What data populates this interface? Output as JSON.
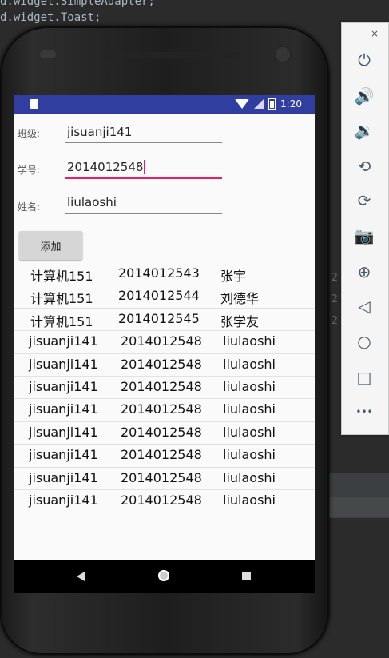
{
  "ide": {
    "line1": "d.widget.SimpleAdapter;",
    "line2": "d.widget.Toast;",
    "gutter": [
      "2",
      "2",
      "2"
    ]
  },
  "statusbar": {
    "time": "1:20"
  },
  "form": {
    "class_label": "班级:",
    "class_value": "jisuanji141",
    "id_label": "学号:",
    "id_value": "2014012548",
    "name_label": "姓名:",
    "name_value": "liulaoshi",
    "add_button": "添加"
  },
  "rows": [
    [
      "计算机151",
      "2014012543",
      "张宇"
    ],
    [
      "计算机151",
      "2014012544",
      "刘德华"
    ],
    [
      "计算机151",
      "2014012545",
      "张学友"
    ],
    [
      "jisuanji141",
      "2014012548",
      "liulaoshi"
    ],
    [
      "jisuanji141",
      "2014012548",
      "liulaoshi"
    ],
    [
      "jisuanji141",
      "2014012548",
      "liulaoshi"
    ],
    [
      "jisuanji141",
      "2014012548",
      "liulaoshi"
    ],
    [
      "jisuanji141",
      "2014012548",
      "liulaoshi"
    ],
    [
      "jisuanji141",
      "2014012548",
      "liulaoshi"
    ],
    [
      "jisuanji141",
      "2014012548",
      "liulaoshi"
    ],
    [
      "jisuanji141",
      "2014012548",
      "liulaoshi"
    ]
  ],
  "toolbar": {
    "minimize": "–",
    "close": "×",
    "buttons": [
      {
        "name": "power-icon",
        "glyph": "⏻"
      },
      {
        "name": "volume-up-icon",
        "glyph": "🔊"
      },
      {
        "name": "volume-down-icon",
        "glyph": "🔉"
      },
      {
        "name": "rotate-left-icon",
        "glyph": "⟲"
      },
      {
        "name": "rotate-right-icon",
        "glyph": "⟳"
      },
      {
        "name": "camera-icon",
        "glyph": "📷"
      },
      {
        "name": "zoom-icon",
        "glyph": "⊕"
      },
      {
        "name": "back-icon",
        "glyph": "◁"
      },
      {
        "name": "home-icon",
        "glyph": "○"
      },
      {
        "name": "overview-icon",
        "glyph": "□"
      },
      {
        "name": "more-icon",
        "glyph": "•••"
      }
    ]
  },
  "colors": {
    "statusbar": "#303f9f",
    "accent": "#e91e63"
  }
}
